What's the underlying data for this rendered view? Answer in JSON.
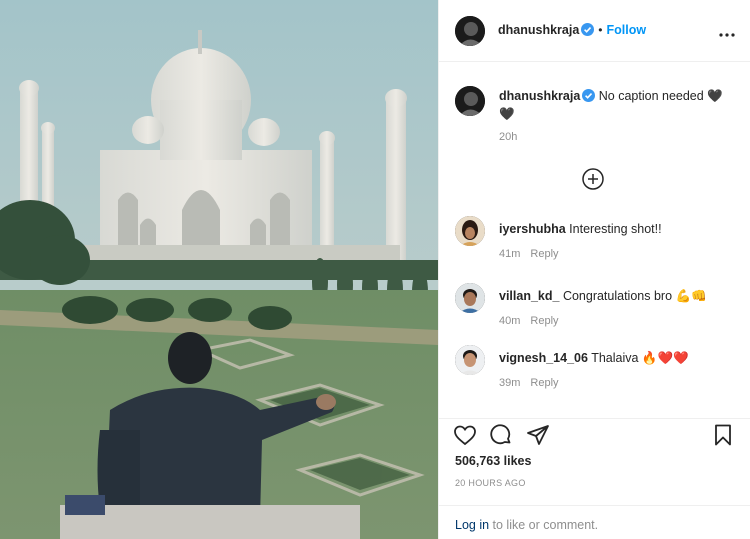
{
  "post": {
    "author": "dhanushkraja",
    "follow_label": "Follow",
    "separator": "•",
    "caption": "No caption needed ",
    "caption_time": "20h"
  },
  "comments": [
    {
      "username": "iyershubha",
      "text": "Interesting shot!!",
      "time": "41m",
      "reply_label": "Reply"
    },
    {
      "username": "villan_kd_",
      "text": "Congratulations bro 💪👊",
      "time": "40m",
      "reply_label": "Reply"
    },
    {
      "username": "vignesh_14_06",
      "text": "Thalaiva 🔥❤️❤️",
      "time": "39m",
      "reply_label": "Reply"
    }
  ],
  "actions": {
    "likes": "506,763 likes",
    "posted_ago": "20 HOURS AGO",
    "login_link": "Log in",
    "login_suffix": " to like or comment."
  },
  "colors": {
    "follow": "#0095f6",
    "verified": "#3897f0",
    "muted": "#8e8e8e",
    "text": "#262626",
    "link": "#00376b"
  },
  "icons": [
    "verified-icon",
    "more-options-icon",
    "load-more-icon",
    "heart-icon",
    "comment-icon",
    "share-icon",
    "bookmark-icon"
  ]
}
